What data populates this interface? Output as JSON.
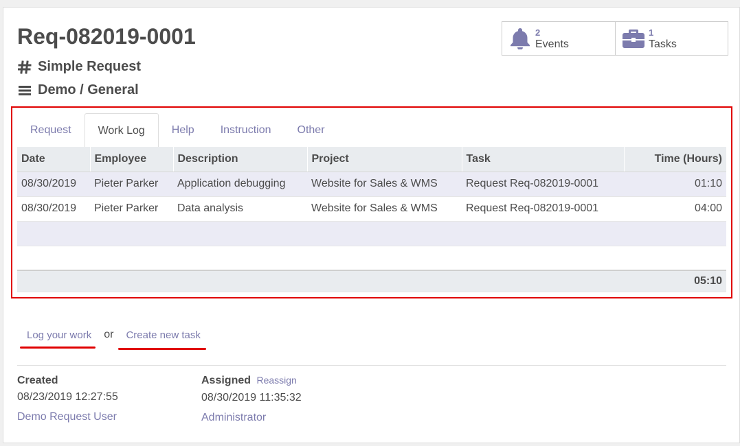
{
  "header": {
    "title": "Req-082019-0001",
    "type": "Simple Request",
    "category": "Demo / General"
  },
  "stats": [
    {
      "count": "2",
      "label": "Events",
      "icon": "bell-icon"
    },
    {
      "count": "1",
      "label": "Tasks",
      "icon": "briefcase-icon"
    }
  ],
  "tabs": [
    {
      "label": "Request",
      "active": false
    },
    {
      "label": "Work Log",
      "active": true
    },
    {
      "label": "Help",
      "active": false
    },
    {
      "label": "Instruction",
      "active": false
    },
    {
      "label": "Other",
      "active": false
    }
  ],
  "worklog": {
    "columns": [
      "Date",
      "Employee",
      "Description",
      "Project",
      "Task",
      "Time (Hours)"
    ],
    "rows": [
      [
        "08/30/2019",
        "Pieter Parker",
        "Application debugging",
        "Website for Sales & WMS",
        "Request Req-082019-0001",
        "01:10"
      ],
      [
        "08/30/2019",
        "Pieter Parker",
        "Data analysis",
        "Website for Sales & WMS",
        "Request Req-082019-0001",
        "04:00"
      ]
    ],
    "total": "05:10"
  },
  "actions": {
    "log_work": "Log your work",
    "or": "or",
    "create_task": "Create new task"
  },
  "created": {
    "heading": "Created",
    "datetime": "08/23/2019 12:27:55",
    "user": "Demo Request User"
  },
  "assigned": {
    "heading": "Assigned",
    "reassign": "Reassign",
    "datetime": "08/30/2019 11:35:32",
    "user": "Administrator"
  },
  "colors": {
    "accent": "#7c7bad",
    "highlight": "#e00000",
    "text": "#4c4c4c"
  }
}
